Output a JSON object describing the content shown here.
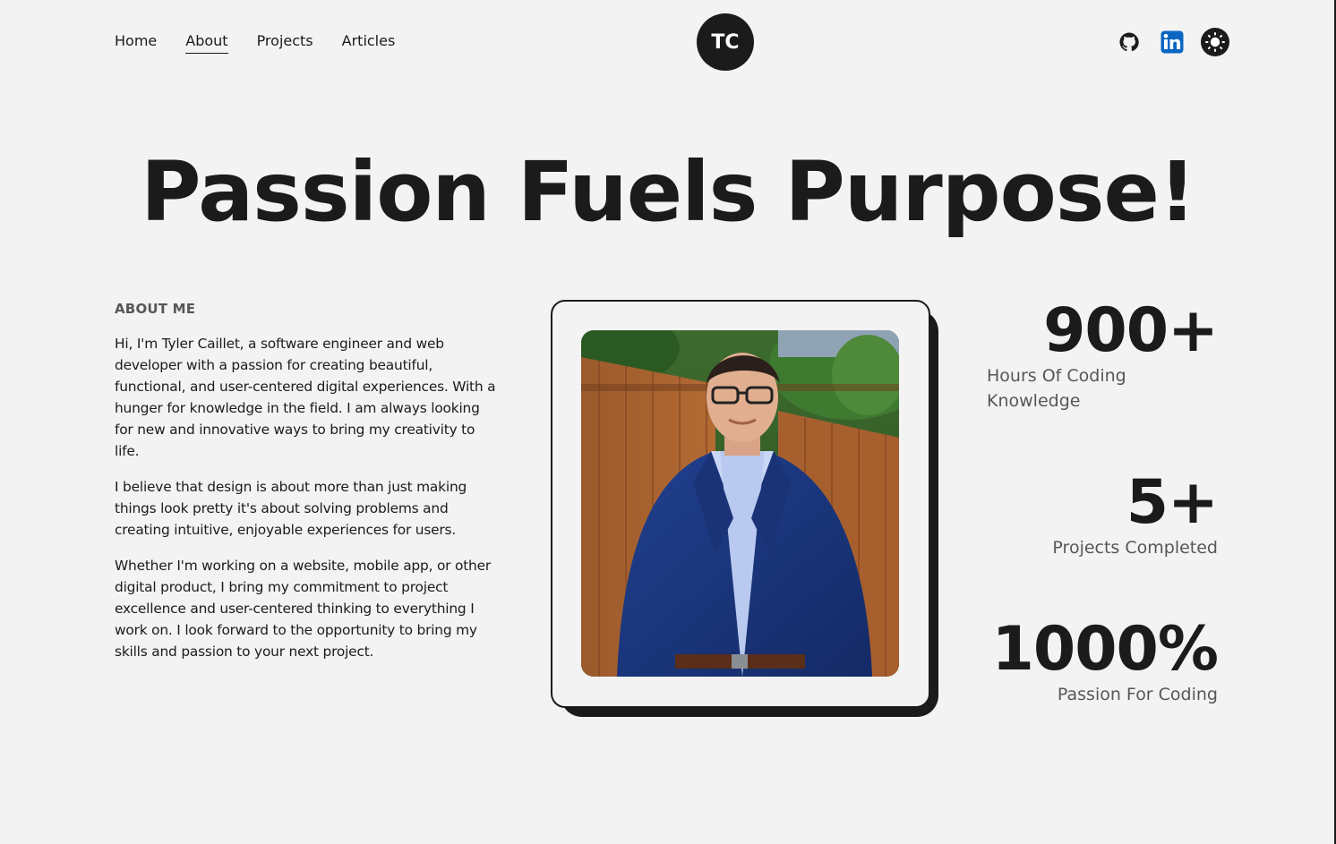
{
  "nav": {
    "items": [
      {
        "label": "Home",
        "active": false
      },
      {
        "label": "About",
        "active": true
      },
      {
        "label": "Projects",
        "active": false
      },
      {
        "label": "Articles",
        "active": false
      }
    ]
  },
  "logo": {
    "text": "TC"
  },
  "social": {
    "github": "github-icon",
    "linkedin": "linkedin-icon",
    "theme": "sun-icon"
  },
  "headline": "Passion Fuels Purpose!",
  "about": {
    "label": "ABOUT ME",
    "paragraphs": [
      "Hi, I'm Tyler Caillet, a software engineer and web developer with a passion for creating beautiful, functional, and user-centered digital experiences. With a hunger for knowledge in the field. I am always looking for new and innovative ways to bring my creativity to life.",
      "I believe that design is about more than just making things look pretty it's about solving problems and creating intuitive, enjoyable experiences for users.",
      "Whether I'm working on a website, mobile app, or other digital product, I bring my commitment to project excellence and user-centered thinking to everything I work on. I look forward to the opportunity to bring my skills and passion to your next project."
    ]
  },
  "stats": [
    {
      "value": "900+",
      "label": "Hours Of Coding Knowledge"
    },
    {
      "value": "5+",
      "label": "Projects Completed"
    },
    {
      "value": "1000%",
      "label": "Passion For Coding"
    }
  ],
  "colors": {
    "background": "#f3f3f3",
    "dark": "#1b1b1b",
    "muted": "#575757",
    "linkedin": "#0a66c2"
  }
}
